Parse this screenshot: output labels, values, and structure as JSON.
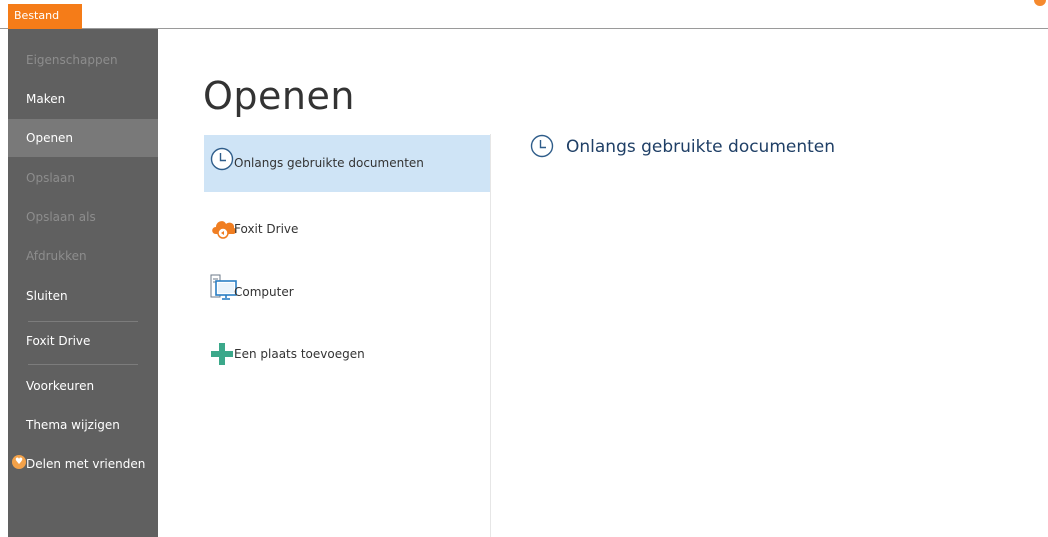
{
  "ribbon": {
    "file_tab_label": "Bestand"
  },
  "nav": {
    "items": [
      {
        "label": "Eigenschappen",
        "state": "disabled"
      },
      {
        "label": "Maken",
        "state": "normal"
      },
      {
        "label": "Openen",
        "state": "active"
      },
      {
        "label": "Opslaan",
        "state": "disabled"
      },
      {
        "label": "Opslaan als",
        "state": "disabled"
      },
      {
        "label": "Afdrukken",
        "state": "disabled"
      },
      {
        "label": "Sluiten",
        "state": "normal"
      },
      {
        "label": "Foxit Drive",
        "state": "normal"
      },
      {
        "label": "Voorkeuren",
        "state": "normal"
      },
      {
        "label": "Thema wijzigen",
        "state": "normal"
      },
      {
        "label": "Delen met vrienden",
        "state": "normal",
        "icon": "heart-icon"
      }
    ]
  },
  "main": {
    "title": "Openen",
    "places": [
      {
        "label": "Onlangs gebruikte documenten",
        "icon": "clock-icon",
        "selected": true
      },
      {
        "label": "Foxit Drive",
        "icon": "cloud-icon",
        "selected": false
      },
      {
        "label": "Computer",
        "icon": "computer-icon",
        "selected": false
      },
      {
        "label": "Een plaats toevoegen",
        "icon": "plus-icon",
        "selected": false
      }
    ],
    "section_title": "Onlangs gebruikte documenten"
  },
  "colors": {
    "accent": "#f57c18",
    "nav_bg": "#606060",
    "nav_active": "#797979",
    "selection": "#cfe4f6",
    "section_title": "#1f3f66"
  }
}
